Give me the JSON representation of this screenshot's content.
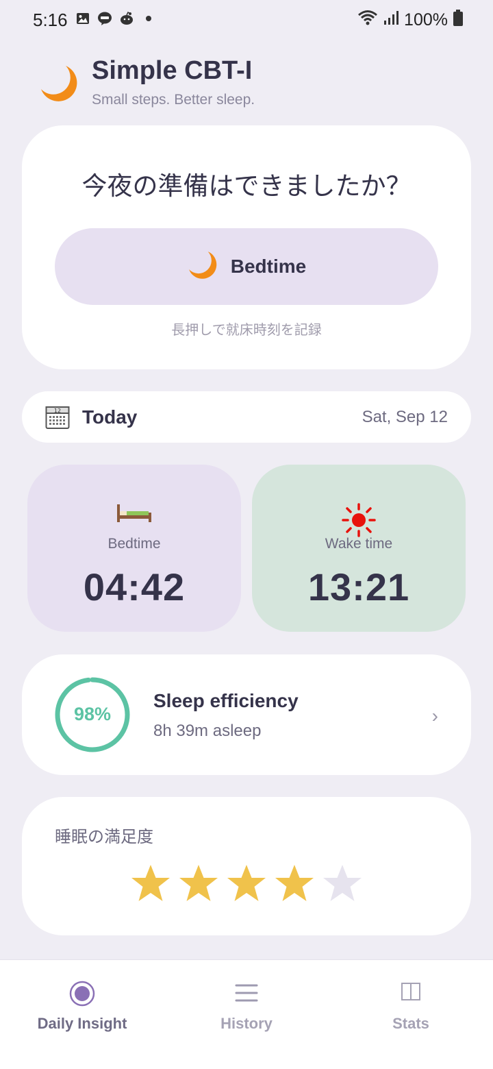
{
  "status": {
    "time": "5:16",
    "battery": "100%"
  },
  "header": {
    "title": "Simple CBT-I",
    "subtitle": "Small steps. Better sleep.",
    "logo_icon": "crescent-moon-icon"
  },
  "prompt": {
    "question": "今夜の準備はできましたか？",
    "button_label": "Bedtime",
    "hint": "長押しで就床時刻を記録"
  },
  "today": {
    "label": "Today",
    "date": "Sat, Sep 12"
  },
  "times": {
    "bedtime_label": "Bedtime",
    "bedtime_value": "04:42",
    "wake_label": "Wake time",
    "wake_value": "13:21"
  },
  "efficiency": {
    "percent": 98,
    "percent_text": "98%",
    "title": "Sleep efficiency",
    "asleep": "8h 39m asleep",
    "chevron": "›"
  },
  "satisfaction": {
    "label": "睡眠の満足度",
    "rating": 4,
    "max": 5
  },
  "nav": {
    "items": [
      {
        "label": "Daily Insight",
        "icon": "daily-insight-icon",
        "active": true
      },
      {
        "label": "History",
        "icon": "history-icon",
        "active": false
      },
      {
        "label": "Stats",
        "icon": "stats-icon",
        "active": false
      }
    ]
  },
  "colors": {
    "background": "#efedf4",
    "accent_purple": "#8a70b5",
    "efficiency_green": "#5cc3a4",
    "star_filled": "#f0c24b",
    "star_empty": "#e6e3ee",
    "moon_orange": "#f28c18"
  }
}
